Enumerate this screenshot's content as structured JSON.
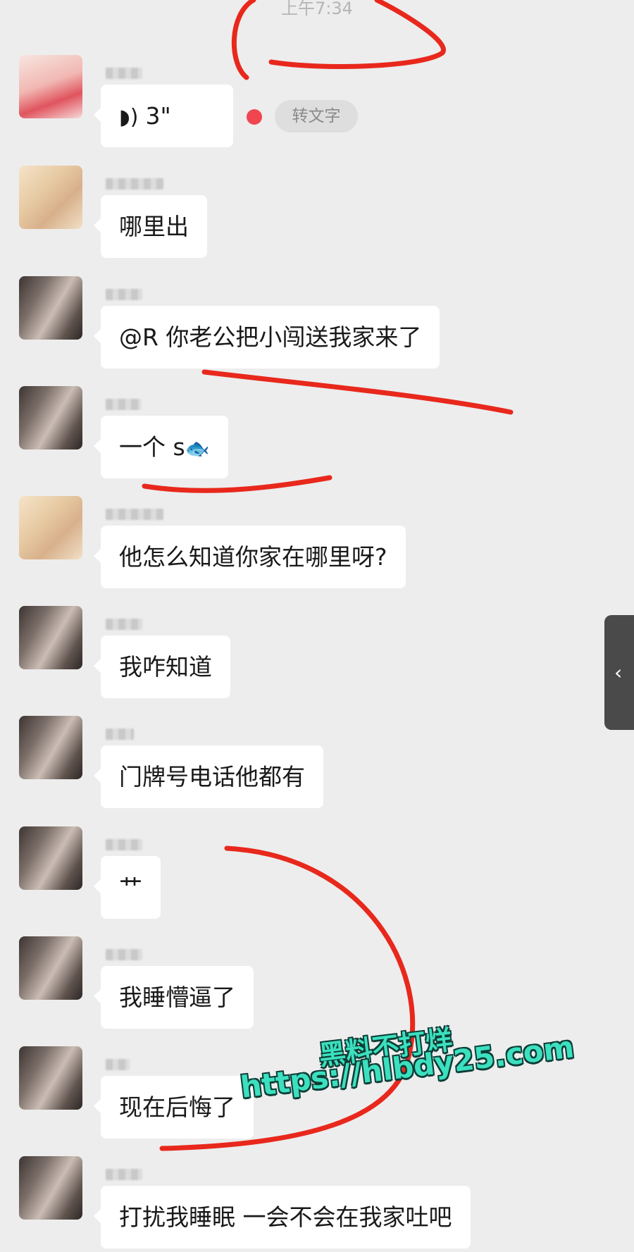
{
  "chat": {
    "timestamp": "上午7:34",
    "voice": {
      "duration": "3\"",
      "to_text": "转文字"
    },
    "messages": [
      "哪里出",
      "@R  你老公把小闯送我家来了",
      "一个 s",
      "他怎么知道你家在哪里呀?",
      "我咋知道",
      "门牌号电话他都有",
      "艹",
      "我睡懵逼了",
      "现在后悔了",
      "打扰我睡眠 一会不会在我家吐吧"
    ],
    "fish_emoji": "🐟"
  },
  "sidebar_handle": {
    "icon": "chevron-left-icon",
    "glyph": "‹"
  },
  "watermark": {
    "line1": "黑料不打烊",
    "line2": "https://hlbdy25.com"
  },
  "colors": {
    "background": "#ededed",
    "bubble": "#ffffff",
    "annotation": "#e8281c",
    "watermark": "#3be0bf"
  }
}
